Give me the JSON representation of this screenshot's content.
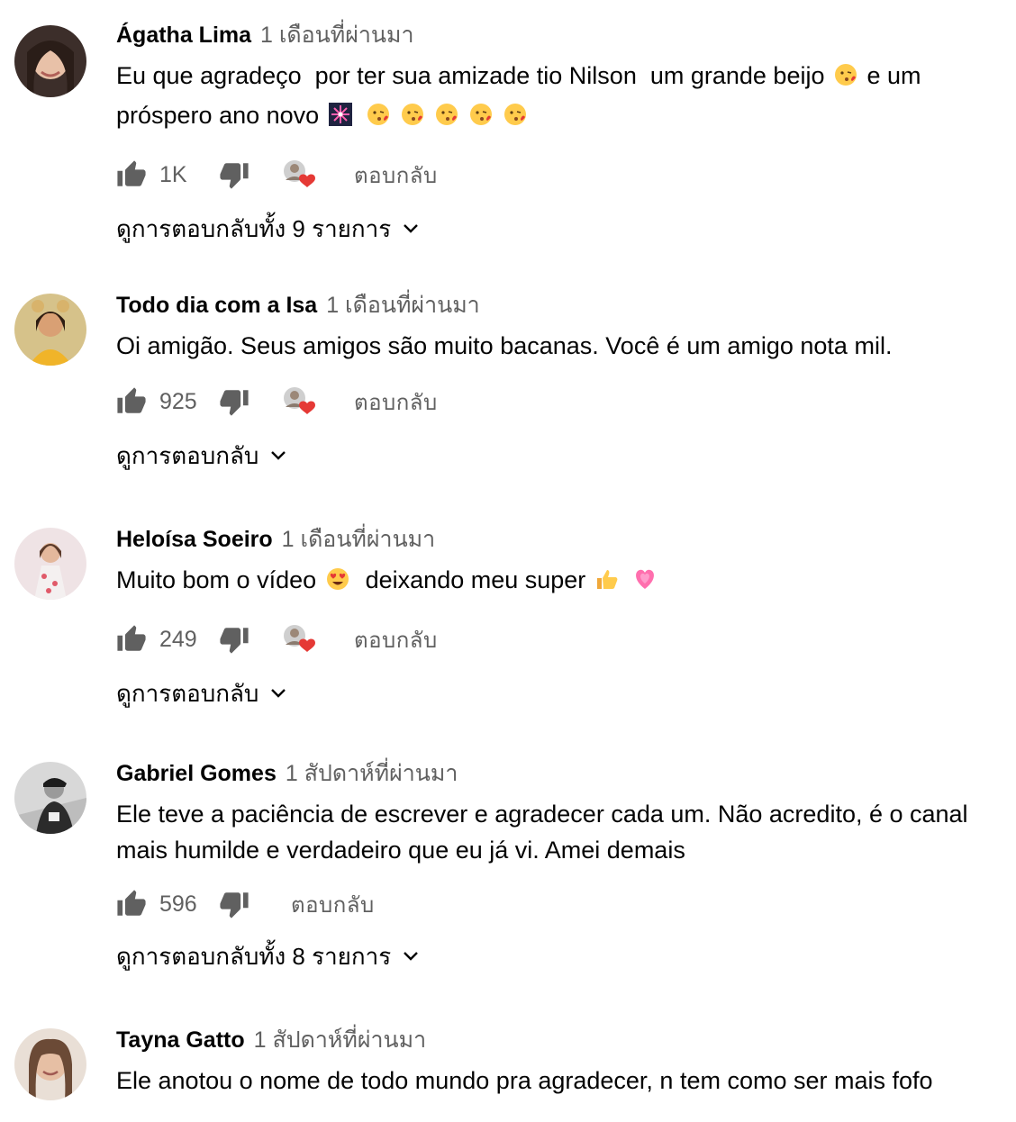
{
  "labels": {
    "reply": "ตอบกลับ"
  },
  "comments": [
    {
      "author": "Ágatha Lima",
      "time": "1 เดือนที่ผ่านมา",
      "text_parts": [
        "Eu que agradeço  por ter sua amizade tio Nilson  um grande beijo ",
        " e um próspero ano novo "
      ],
      "likes": "1K",
      "replies_label": "ดูการตอบกลับทั้ง 9 รายการ",
      "avatar_color": "#6b4a3c"
    },
    {
      "author": "Todo dia com a Isa",
      "time": "1 เดือนที่ผ่านมา",
      "text": "Oi amigão. Seus amigos são muito bacanas. Você é um amigo nota mil.",
      "likes": "925",
      "replies_label": "ดูการตอบกลับ",
      "avatar_color": "#e3a637"
    },
    {
      "author": "Heloísa Soeiro",
      "time": "1 เดือนที่ผ่านมา",
      "text_parts": [
        "Muito bom o vídeo ",
        "  deixando meu super "
      ],
      "likes": "249",
      "replies_label": "ดูการตอบกลับ",
      "avatar_color": "#d9a7ae"
    },
    {
      "author": "Gabriel Gomes",
      "time": "1 สัปดาห์ที่ผ่านมา",
      "text": "Ele teve a paciência de escrever e agradecer cada um. Não acredito, é o canal mais humilde e verdadeiro que eu já vi. Amei demais",
      "likes": "596",
      "replies_label": "ดูการตอบกลับทั้ง 8 รายการ",
      "avatar_color": "#555555"
    },
    {
      "author": "Tayna Gatto",
      "time": "1 สัปดาห์ที่ผ่านมา",
      "text": "Ele anotou o nome de todo mundo pra agradecer, n tem como ser mais fofo",
      "avatar_color": "#a07a62"
    }
  ],
  "colors": {
    "secondary_text": "#606060",
    "heart": "#e53935",
    "icon": "#606060"
  }
}
